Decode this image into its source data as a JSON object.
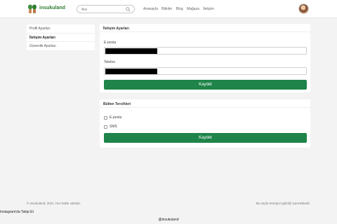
{
  "header": {
    "logo_text": "insukuland",
    "search_placeholder": "Ara",
    "nav": [
      "Anasayfa",
      "Bitkiler",
      "Blog",
      "Mağaza",
      "İletişim"
    ]
  },
  "sidebar": {
    "items": [
      {
        "label": "Profil Ayarları"
      },
      {
        "label": "İletişim Ayarları"
      },
      {
        "label": "Güvenlik Ayarları"
      }
    ]
  },
  "contact": {
    "title": "İletişim Ayarları",
    "email_label": "E-posta",
    "phone_label": "Telefon",
    "save_label": "Kaydet"
  },
  "newsletter": {
    "title": "Bülten Tercihleri",
    "option_email": "E-posta",
    "option_sms": "SMS",
    "save_label": "Kaydet"
  },
  "footer": {
    "copyright": "© insukuland, 2021. Her hakkı saklıdır.",
    "credit": "Bu sayfa trendyol ıgbirl@ içermektedir.",
    "instagram": "Instagram'da Takip Et",
    "handle": "@insukuland"
  },
  "colors": {
    "accent": "#1e8449",
    "brand_text": "#2e7d32",
    "background": "#f3f3f3"
  }
}
